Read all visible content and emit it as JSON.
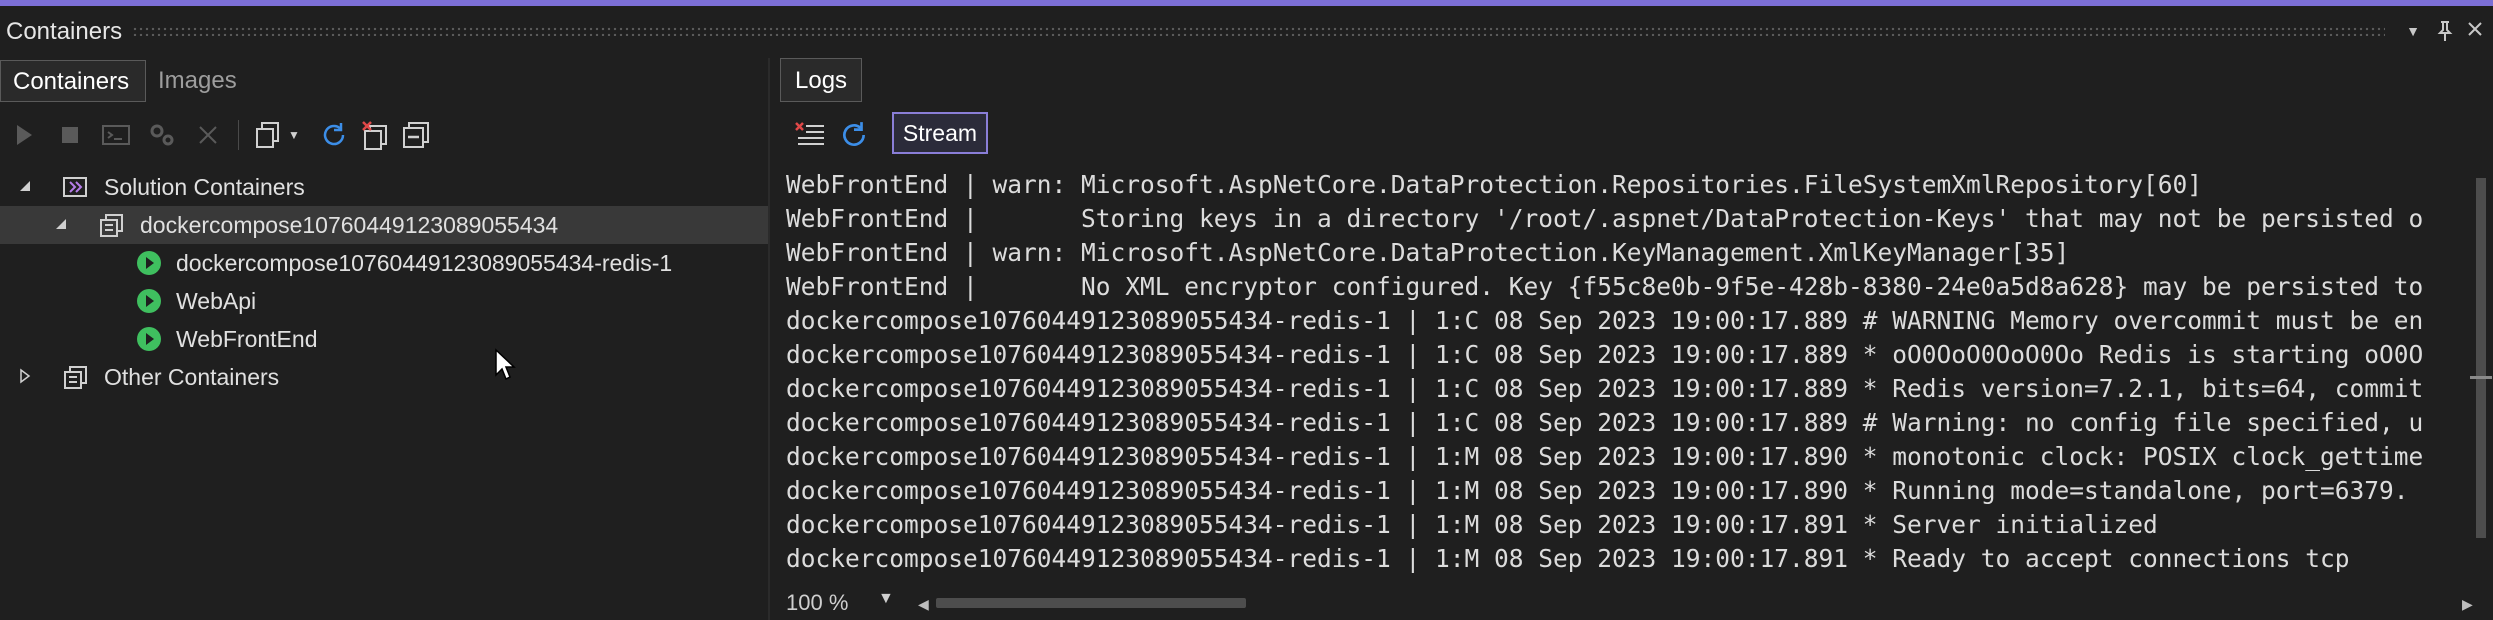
{
  "window": {
    "title": "Containers"
  },
  "left_tabs": [
    {
      "label": "Containers",
      "active": true
    },
    {
      "label": "Images",
      "active": false
    }
  ],
  "toolbar_icons": [
    "start-icon",
    "stop-icon",
    "terminal-icon",
    "settings-icon",
    "remove-icon",
    "copy-icon",
    "dropdown-icon",
    "refresh-icon",
    "prune-icon",
    "collapse-all-icon"
  ],
  "tree": {
    "solution": {
      "label": "Solution Containers"
    },
    "compose": {
      "label": "dockercompose10760449123089055434"
    },
    "children": [
      {
        "label": "dockercompose10760449123089055434-redis-1"
      },
      {
        "label": "WebApi"
      },
      {
        "label": "WebFrontEnd"
      }
    ],
    "other": {
      "label": "Other Containers"
    }
  },
  "logs": {
    "tab_label": "Logs",
    "stream_label": "Stream",
    "lines": [
      "WebFrontEnd | warn: Microsoft.AspNetCore.DataProtection.Repositories.FileSystemXmlRepository[60]",
      "WebFrontEnd |       Storing keys in a directory '/root/.aspnet/DataProtection-Keys' that may not be persisted o",
      "WebFrontEnd | warn: Microsoft.AspNetCore.DataProtection.KeyManagement.XmlKeyManager[35]",
      "WebFrontEnd |       No XML encryptor configured. Key {f55c8e0b-9f5e-428b-8380-24e0a5d8a628} may be persisted to",
      "dockercompose10760449123089055434-redis-1 | 1:C 08 Sep 2023 19:00:17.889 # WARNING Memory overcommit must be en",
      "dockercompose10760449123089055434-redis-1 | 1:C 08 Sep 2023 19:00:17.889 * oO0OoO0OoO0Oo Redis is starting oO0O",
      "dockercompose10760449123089055434-redis-1 | 1:C 08 Sep 2023 19:00:17.889 * Redis version=7.2.1, bits=64, commit",
      "dockercompose10760449123089055434-redis-1 | 1:C 08 Sep 2023 19:00:17.889 # Warning: no config file specified, u",
      "dockercompose10760449123089055434-redis-1 | 1:M 08 Sep 2023 19:00:17.890 * monotonic clock: POSIX clock_gettime",
      "dockercompose10760449123089055434-redis-1 | 1:M 08 Sep 2023 19:00:17.890 * Running mode=standalone, port=6379.",
      "dockercompose10760449123089055434-redis-1 | 1:M 08 Sep 2023 19:00:17.891 * Server initialized",
      "dockercompose10760449123089055434-redis-1 | 1:M 08 Sep 2023 19:00:17.891 * Ready to accept connections tcp"
    ]
  },
  "zoom": {
    "value": "100 %"
  },
  "colors": {
    "accent": "#7c6fd6",
    "running": "#3fbf5f",
    "background": "#1f1f1f"
  }
}
